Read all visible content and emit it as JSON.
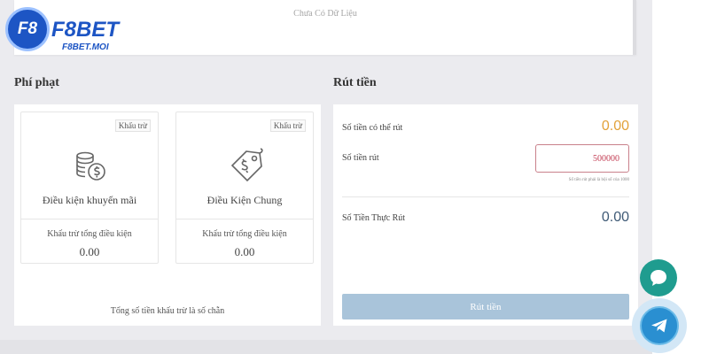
{
  "brand": {
    "logo_mark": "F8",
    "name": "F8BET",
    "domain": "F8BET.MOI",
    "color": "#1d55c4"
  },
  "top_card": {
    "empty_text": "Chưa Có Dữ Liệu"
  },
  "penalty": {
    "title": "Phí phạt",
    "cards": [
      {
        "tag": "Khấu trừ",
        "name": "Điều kiện khuyến mãi",
        "icon": "money-coins-icon",
        "sub_label": "Khấu trừ tổng điều kiện",
        "value": "0.00"
      },
      {
        "tag": "Khấu trừ",
        "name": "Điều Kiện Chung",
        "icon": "price-tag-icon",
        "sub_label": "Khấu trừ tổng điều kiện",
        "value": "0.00"
      }
    ],
    "footer": "Tổng số tiền khấu trừ là số chẵn"
  },
  "withdraw": {
    "title": "Rút tiền",
    "available_label": "Số tiền có thể rút",
    "available_value": "0.00",
    "amount_label": "Số tiền rút",
    "amount_value": "500000",
    "hint": "Số tiền rút phải là bội số của 1000",
    "actual_label": "Số Tiền Thực Rút",
    "actual_value": "0.00",
    "button_label": "Rút tiền"
  },
  "floating": {
    "chat_icon": "chat-bubble-icon",
    "telegram_icon": "telegram-icon"
  },
  "colors": {
    "available_value": "#e2a23a",
    "actual_value": "#3f5a76",
    "button": "#a9c4da",
    "chat": "#1f9c8f",
    "telegram": "#2a8fd1"
  }
}
